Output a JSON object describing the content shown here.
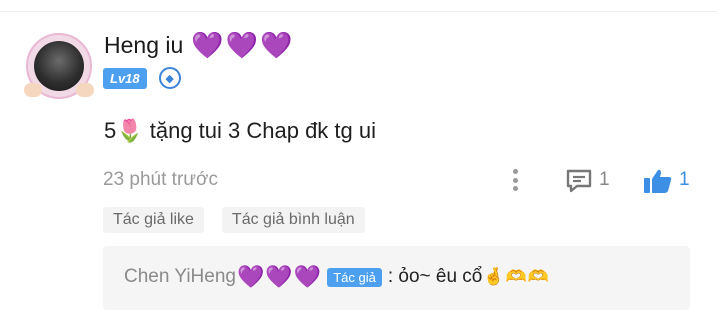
{
  "comment": {
    "username": "Heng iu",
    "username_hearts": [
      "💜",
      "💜",
      "💜"
    ],
    "level_badge": "Lv18",
    "text": "5🌷 tặng tui 3 Chap đk tg ui",
    "timestamp": "23 phút trước",
    "reply_count": "1",
    "like_count": "1",
    "tags": [
      "Tác giả like",
      "Tác giả bình luận"
    ],
    "reply": {
      "author": "Chen YiHeng",
      "author_hearts": [
        "💜",
        "💜",
        "💜"
      ],
      "author_badge": "Tác giả",
      "text": ": ỏo~ êu cổ",
      "emojis": [
        "🤞",
        "🫶",
        "🫶"
      ]
    }
  },
  "colors": {
    "accent_blue": "#4d9ff0",
    "heart_purple": "#a23fe6",
    "like_blue": "#3d8fe6"
  }
}
